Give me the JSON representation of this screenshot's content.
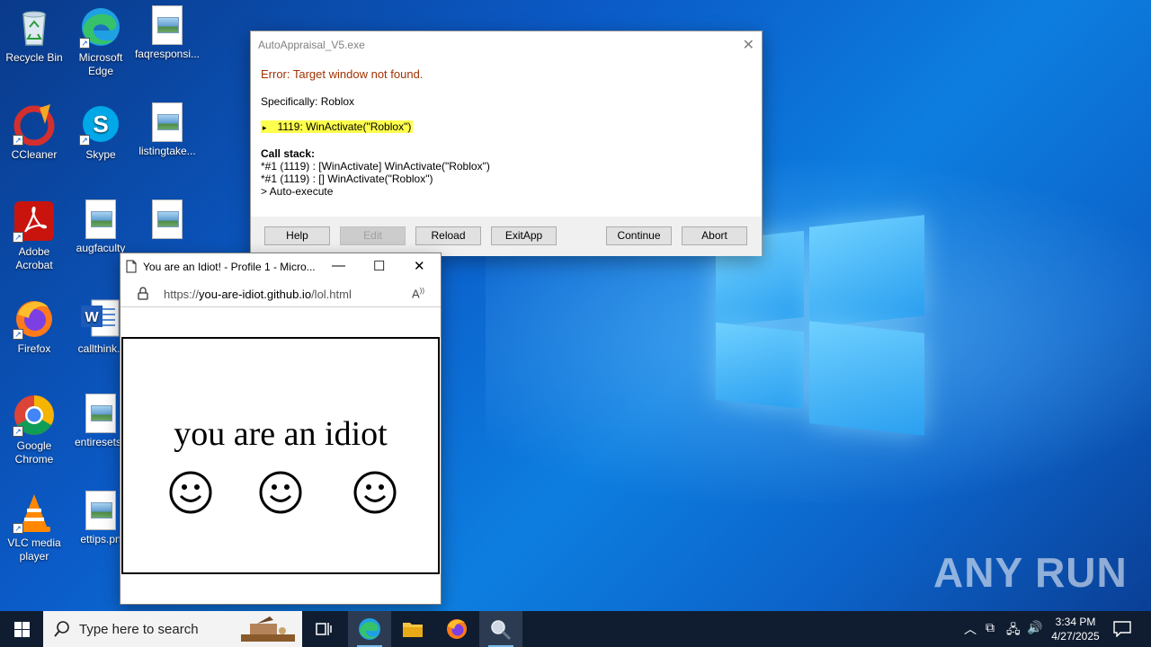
{
  "desktop": {
    "icons": [
      {
        "label": "Recycle Bin",
        "icon": "recycle-bin-icon"
      },
      {
        "label": "Microsoft Edge",
        "icon": "edge-icon"
      },
      {
        "label": "faqresponsi...",
        "icon": "image-file-icon"
      },
      {
        "label": "CCleaner",
        "icon": "ccleaner-icon"
      },
      {
        "label": "Skype",
        "icon": "skype-icon"
      },
      {
        "label": "listingtake...",
        "icon": "image-file-icon"
      },
      {
        "label": "Adobe Acrobat",
        "icon": "acrobat-icon"
      },
      {
        "label": "augfaculty",
        "icon": "image-file-icon"
      },
      {
        "label": "Firefox",
        "icon": "firefox-icon"
      },
      {
        "label": "callthink.r",
        "icon": "word-file-icon"
      },
      {
        "label": "Google Chrome",
        "icon": "chrome-icon"
      },
      {
        "label": "entiresets.j",
        "icon": "image-file-icon"
      },
      {
        "label": "VLC media player",
        "icon": "vlc-icon"
      },
      {
        "label": "ettips.pn",
        "icon": "image-file-icon"
      }
    ]
  },
  "dialog": {
    "title": "AutoAppraisal_V5.exe",
    "error": "Error: Target window not found.",
    "specifically": "Specifically: Roblox",
    "line_marker": "▸",
    "highlighted_line": "1119: WinActivate(\"Roblox\")",
    "call_stack_label": "Call stack:",
    "stack": [
      "*#1 (1119) : [WinActivate] WinActivate(\"Roblox\")",
      "*#1 (1119) : [] WinActivate(\"Roblox\")",
      "> Auto-execute"
    ],
    "buttons": {
      "help": "Help",
      "edit": "Edit",
      "reload": "Reload",
      "exitapp": "ExitApp",
      "continue": "Continue",
      "abort": "Abort"
    }
  },
  "browser": {
    "title": "You are an Idiot! - Profile 1 - Micro...",
    "url_prefix": "https://",
    "url_domain": "you-are-idiot.github.io",
    "url_path": "/lol.html",
    "page_text": "you are an idiot",
    "smiley": "☺"
  },
  "taskbar": {
    "search_placeholder": "Type here to search",
    "time": "3:34 PM",
    "date": "4/27/2025",
    "accent": "#76b9ed"
  },
  "watermark": "ANY RUN"
}
